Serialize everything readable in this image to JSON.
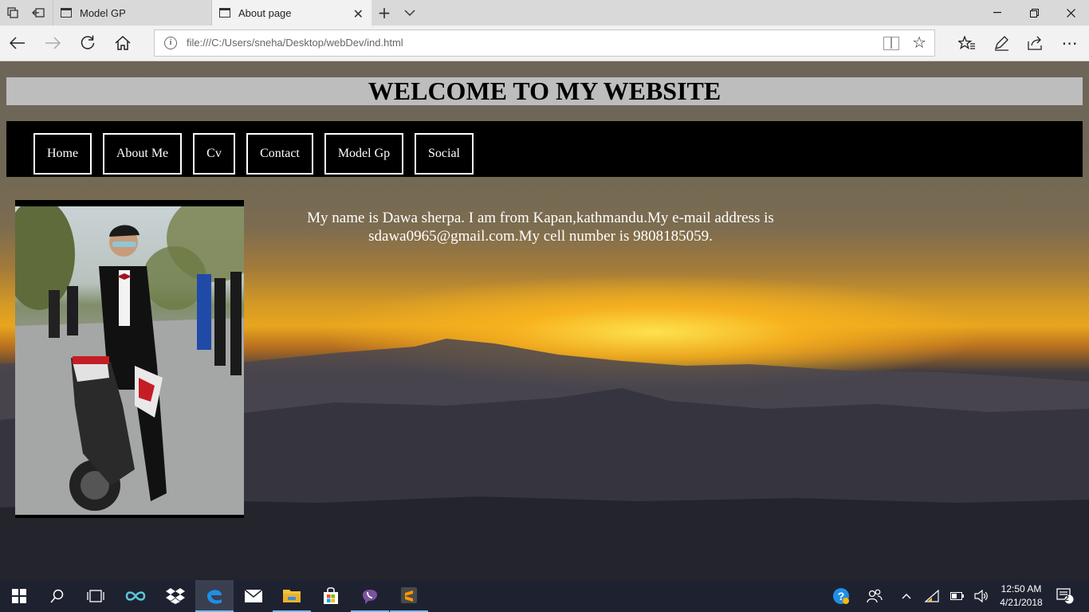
{
  "browser": {
    "tabs": [
      {
        "title": "Model GP",
        "active": false
      },
      {
        "title": "About page",
        "active": true
      }
    ],
    "address_url": "file:///C:/Users/sneha/Desktop/webDev/ind.html"
  },
  "page": {
    "header_title": "WELCOME TO MY WEBSITE",
    "nav_links": [
      "Home",
      "About Me",
      "Cv",
      "Contact",
      "Model Gp",
      "Social"
    ],
    "bio_text": "My name is Dawa sherpa. I am from Kapan,kathmandu.My e-mail address is sdawa0965@gmail.com.My cell number is 9808185059."
  },
  "taskbar": {
    "time": "12:50 AM",
    "date": "4/21/2018",
    "notification_count": "2",
    "apps": [
      "start-icon",
      "search-icon",
      "task-view-icon",
      "infinity-app-icon",
      "dropbox-icon",
      "edge-icon",
      "mail-icon",
      "file-explorer-icon",
      "store-icon",
      "viber-icon",
      "sublime-text-icon"
    ]
  },
  "colors": {
    "header_bg": "#bdbdbd",
    "nav_bg": "#000000",
    "taskbar_bg": "#1e2230",
    "sun_glow": "#e8a61e"
  }
}
